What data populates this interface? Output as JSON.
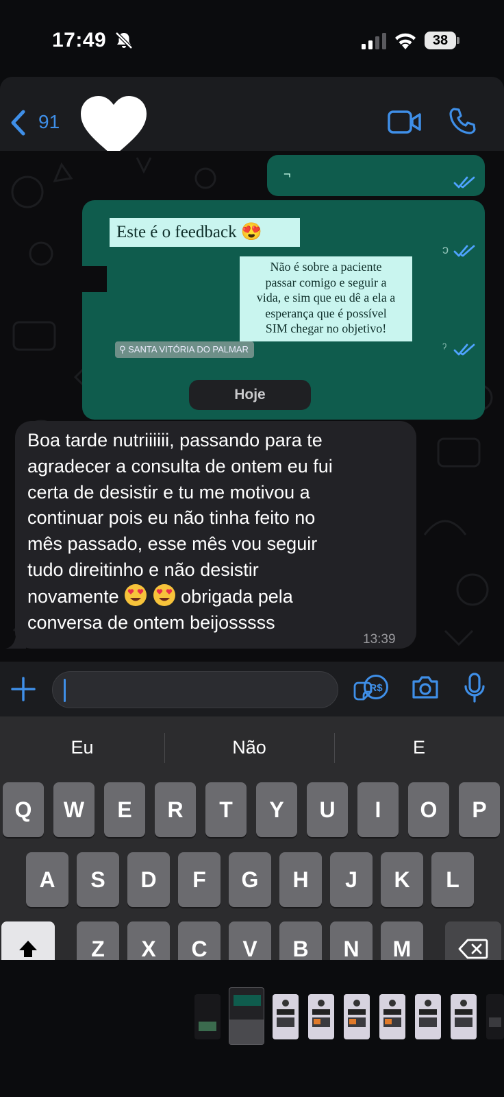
{
  "status_bar": {
    "time": "17:49",
    "battery_level": "38"
  },
  "header": {
    "back_count": "91",
    "avatar": "heart-sticker",
    "accent_color": "#3f8fe8"
  },
  "messages": {
    "outgoing_1_text": "¬",
    "feedback_sticker": "Este é o feedback 😍",
    "quote_sticker_lines": [
      "Não é sobre a paciente",
      "passar comigo e seguir a",
      "vida, e sim que eu dê a ela a",
      "esperança que é possível",
      "SIM chegar no objetivo!"
    ],
    "location_tag": "SANTA VITÓRIA DO PALMAR",
    "date_separator": "Hoje",
    "incoming_text_lines": [
      "Boa tarde nutriiiiii, passando para te",
      "agradecer a consulta de ontem eu fui",
      "certa de desistir  e tu me motivou a",
      "continuar pois eu não tinha feito no",
      "mês passado, esse mês vou seguir",
      "tudo direitinho e não desistir",
      "novamente",
      "obrigada pela",
      "conversa de ontem beijosssss"
    ],
    "incoming_time": "13:39",
    "bubble_color_outgoing": "#0f5c4d",
    "bubble_color_incoming": "#222226"
  },
  "input": {
    "placeholder": ""
  },
  "keyboard": {
    "suggestions": [
      "Eu",
      "Não",
      "E"
    ],
    "row1": [
      "Q",
      "W",
      "E",
      "R",
      "T",
      "Y",
      "U",
      "I",
      "O",
      "P"
    ],
    "row2": [
      "A",
      "S",
      "D",
      "F",
      "G",
      "H",
      "J",
      "K",
      "L"
    ],
    "row3": [
      "Z",
      "X",
      "C",
      "V",
      "B",
      "N",
      "M"
    ]
  }
}
